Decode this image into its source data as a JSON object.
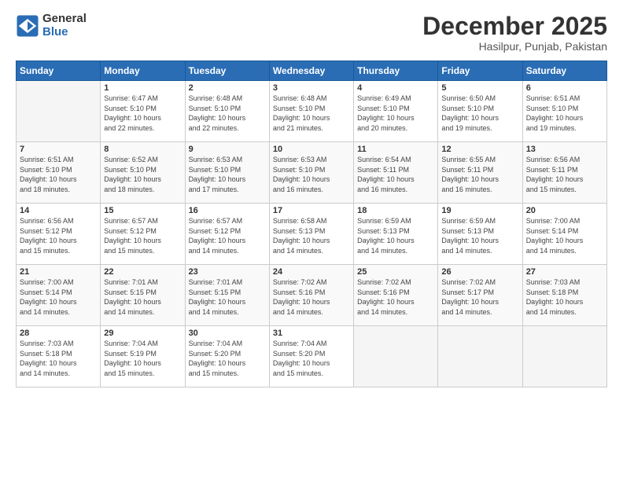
{
  "logo": {
    "general": "General",
    "blue": "Blue"
  },
  "header": {
    "month_year": "December 2025",
    "location": "Hasilpur, Punjab, Pakistan"
  },
  "days_of_week": [
    "Sunday",
    "Monday",
    "Tuesday",
    "Wednesday",
    "Thursday",
    "Friday",
    "Saturday"
  ],
  "weeks": [
    [
      {
        "day": "",
        "info": ""
      },
      {
        "day": "1",
        "info": "Sunrise: 6:47 AM\nSunset: 5:10 PM\nDaylight: 10 hours\nand 22 minutes."
      },
      {
        "day": "2",
        "info": "Sunrise: 6:48 AM\nSunset: 5:10 PM\nDaylight: 10 hours\nand 22 minutes."
      },
      {
        "day": "3",
        "info": "Sunrise: 6:48 AM\nSunset: 5:10 PM\nDaylight: 10 hours\nand 21 minutes."
      },
      {
        "day": "4",
        "info": "Sunrise: 6:49 AM\nSunset: 5:10 PM\nDaylight: 10 hours\nand 20 minutes."
      },
      {
        "day": "5",
        "info": "Sunrise: 6:50 AM\nSunset: 5:10 PM\nDaylight: 10 hours\nand 19 minutes."
      },
      {
        "day": "6",
        "info": "Sunrise: 6:51 AM\nSunset: 5:10 PM\nDaylight: 10 hours\nand 19 minutes."
      }
    ],
    [
      {
        "day": "7",
        "info": "Sunrise: 6:51 AM\nSunset: 5:10 PM\nDaylight: 10 hours\nand 18 minutes."
      },
      {
        "day": "8",
        "info": "Sunrise: 6:52 AM\nSunset: 5:10 PM\nDaylight: 10 hours\nand 18 minutes."
      },
      {
        "day": "9",
        "info": "Sunrise: 6:53 AM\nSunset: 5:10 PM\nDaylight: 10 hours\nand 17 minutes."
      },
      {
        "day": "10",
        "info": "Sunrise: 6:53 AM\nSunset: 5:10 PM\nDaylight: 10 hours\nand 16 minutes."
      },
      {
        "day": "11",
        "info": "Sunrise: 6:54 AM\nSunset: 5:11 PM\nDaylight: 10 hours\nand 16 minutes."
      },
      {
        "day": "12",
        "info": "Sunrise: 6:55 AM\nSunset: 5:11 PM\nDaylight: 10 hours\nand 16 minutes."
      },
      {
        "day": "13",
        "info": "Sunrise: 6:56 AM\nSunset: 5:11 PM\nDaylight: 10 hours\nand 15 minutes."
      }
    ],
    [
      {
        "day": "14",
        "info": "Sunrise: 6:56 AM\nSunset: 5:12 PM\nDaylight: 10 hours\nand 15 minutes."
      },
      {
        "day": "15",
        "info": "Sunrise: 6:57 AM\nSunset: 5:12 PM\nDaylight: 10 hours\nand 15 minutes."
      },
      {
        "day": "16",
        "info": "Sunrise: 6:57 AM\nSunset: 5:12 PM\nDaylight: 10 hours\nand 14 minutes."
      },
      {
        "day": "17",
        "info": "Sunrise: 6:58 AM\nSunset: 5:13 PM\nDaylight: 10 hours\nand 14 minutes."
      },
      {
        "day": "18",
        "info": "Sunrise: 6:59 AM\nSunset: 5:13 PM\nDaylight: 10 hours\nand 14 minutes."
      },
      {
        "day": "19",
        "info": "Sunrise: 6:59 AM\nSunset: 5:13 PM\nDaylight: 10 hours\nand 14 minutes."
      },
      {
        "day": "20",
        "info": "Sunrise: 7:00 AM\nSunset: 5:14 PM\nDaylight: 10 hours\nand 14 minutes."
      }
    ],
    [
      {
        "day": "21",
        "info": "Sunrise: 7:00 AM\nSunset: 5:14 PM\nDaylight: 10 hours\nand 14 minutes."
      },
      {
        "day": "22",
        "info": "Sunrise: 7:01 AM\nSunset: 5:15 PM\nDaylight: 10 hours\nand 14 minutes."
      },
      {
        "day": "23",
        "info": "Sunrise: 7:01 AM\nSunset: 5:15 PM\nDaylight: 10 hours\nand 14 minutes."
      },
      {
        "day": "24",
        "info": "Sunrise: 7:02 AM\nSunset: 5:16 PM\nDaylight: 10 hours\nand 14 minutes."
      },
      {
        "day": "25",
        "info": "Sunrise: 7:02 AM\nSunset: 5:16 PM\nDaylight: 10 hours\nand 14 minutes."
      },
      {
        "day": "26",
        "info": "Sunrise: 7:02 AM\nSunset: 5:17 PM\nDaylight: 10 hours\nand 14 minutes."
      },
      {
        "day": "27",
        "info": "Sunrise: 7:03 AM\nSunset: 5:18 PM\nDaylight: 10 hours\nand 14 minutes."
      }
    ],
    [
      {
        "day": "28",
        "info": "Sunrise: 7:03 AM\nSunset: 5:18 PM\nDaylight: 10 hours\nand 14 minutes."
      },
      {
        "day": "29",
        "info": "Sunrise: 7:04 AM\nSunset: 5:19 PM\nDaylight: 10 hours\nand 15 minutes."
      },
      {
        "day": "30",
        "info": "Sunrise: 7:04 AM\nSunset: 5:20 PM\nDaylight: 10 hours\nand 15 minutes."
      },
      {
        "day": "31",
        "info": "Sunrise: 7:04 AM\nSunset: 5:20 PM\nDaylight: 10 hours\nand 15 minutes."
      },
      {
        "day": "",
        "info": ""
      },
      {
        "day": "",
        "info": ""
      },
      {
        "day": "",
        "info": ""
      }
    ]
  ]
}
